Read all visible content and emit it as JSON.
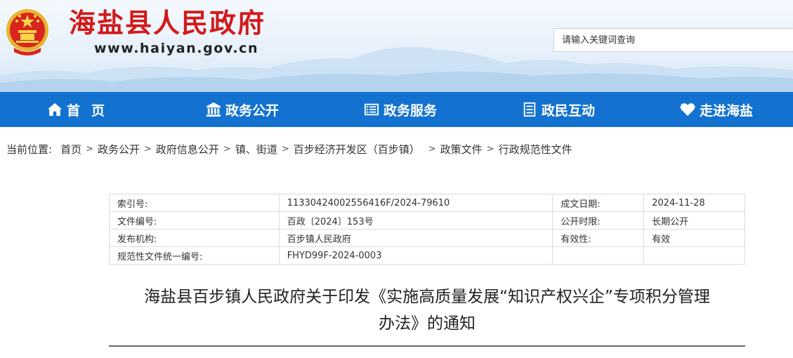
{
  "header": {
    "site_title": "海盐县人民政府",
    "site_url": "www.haiyan.gov.cn",
    "emblem_icon": "national-emblem-icon",
    "search": {
      "placeholder": "请输入关键词查询",
      "value": ""
    }
  },
  "nav": {
    "color": "#1372cf",
    "items": [
      {
        "label": "首页",
        "icon": "home-icon"
      },
      {
        "label": "政务公开",
        "icon": "building-icon"
      },
      {
        "label": "政务服务",
        "icon": "list-icon"
      },
      {
        "label": "政民互动",
        "icon": "document-icon"
      },
      {
        "label": "走进海盐",
        "icon": "heart-icon"
      }
    ]
  },
  "breadcrumb": {
    "prefix": "当前位置:",
    "items": [
      "首页",
      "政务公开",
      "政府信息公开",
      "镇、街道",
      "百步经济开发区（百步镇）",
      "政策文件",
      "行政规范性文件"
    ]
  },
  "info": {
    "rows": [
      {
        "k1": "索引号:",
        "v1": "11330424002556416F/2024-79610",
        "k2": "成文日期:",
        "v2": "2024-11-28"
      },
      {
        "k1": "文件编号:",
        "v1": "百政〔2024〕153号",
        "k2": "公开时限:",
        "v2": "长期公开"
      },
      {
        "k1": "发布机构:",
        "v1": "百步镇人民政府",
        "k2": "有效性:",
        "v2": "有效"
      },
      {
        "k1": "规范性文件统一编号:",
        "v1": "FHYD99F-2024-0003",
        "k2": "",
        "v2": ""
      }
    ]
  },
  "document": {
    "title_line1": "海盐县百步镇人民政府关于印发《实施高质量发展“知识产权兴企”专项积分管理",
    "title_line2": "办法》的通知"
  }
}
